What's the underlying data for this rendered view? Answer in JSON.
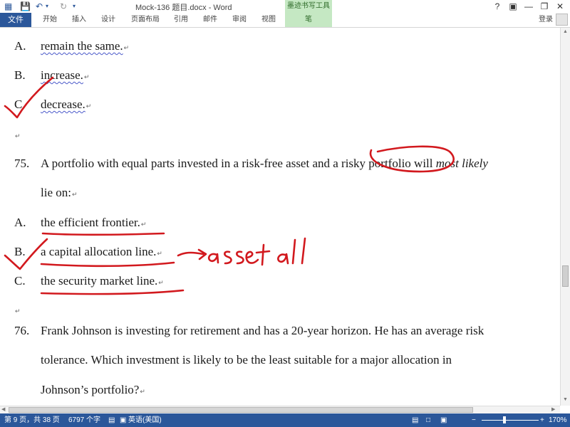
{
  "window": {
    "title": "Mock-136 题目.docx - Word",
    "ink_tools_title": "墨迹书写工具",
    "help": "?"
  },
  "ribbon": {
    "file_tab": "文件",
    "tabs": [
      "开始",
      "插入",
      "设计",
      "页面布局",
      "引用",
      "邮件",
      "审阅",
      "视图"
    ],
    "pen_tab": "笔",
    "login": "登录"
  },
  "document": {
    "prev_options": [
      {
        "letter": "A.",
        "text": "remain the same."
      },
      {
        "letter": "B.",
        "text": "increase."
      },
      {
        "letter": "C.",
        "text": "decrease."
      }
    ],
    "q75": {
      "number": "75.",
      "line1_prefix": "A portfolio with equal parts invested in a risk-free asset and a risky portfolio will ",
      "line1_italic": "most likely",
      "line2": "lie on:",
      "options": [
        {
          "letter": "A.",
          "text": "the efficient frontier."
        },
        {
          "letter": "B.",
          "text": "a capital allocation line."
        },
        {
          "letter": "C.",
          "text": "the security market line."
        }
      ]
    },
    "q76": {
      "number": "76.",
      "lines": [
        "Frank Johnson is investing for retirement and has a 20-year horizon. He has an average risk",
        "tolerance. Which investment is likely to be the least suitable for a major allocation in",
        "Johnson’s portfolio?"
      ]
    },
    "paragraph_mark": "↵",
    "ink_color": "#d2191e",
    "ink_annotation": "asset all"
  },
  "statusbar": {
    "page": "第 9 页，共 38 页",
    "words": "6797 个字",
    "language": "英语(美国)",
    "zoom": "170%",
    "zoom_level": 0.4
  },
  "colors": {
    "accent": "#2b579a",
    "ink_tab": "#c5e8c3"
  }
}
